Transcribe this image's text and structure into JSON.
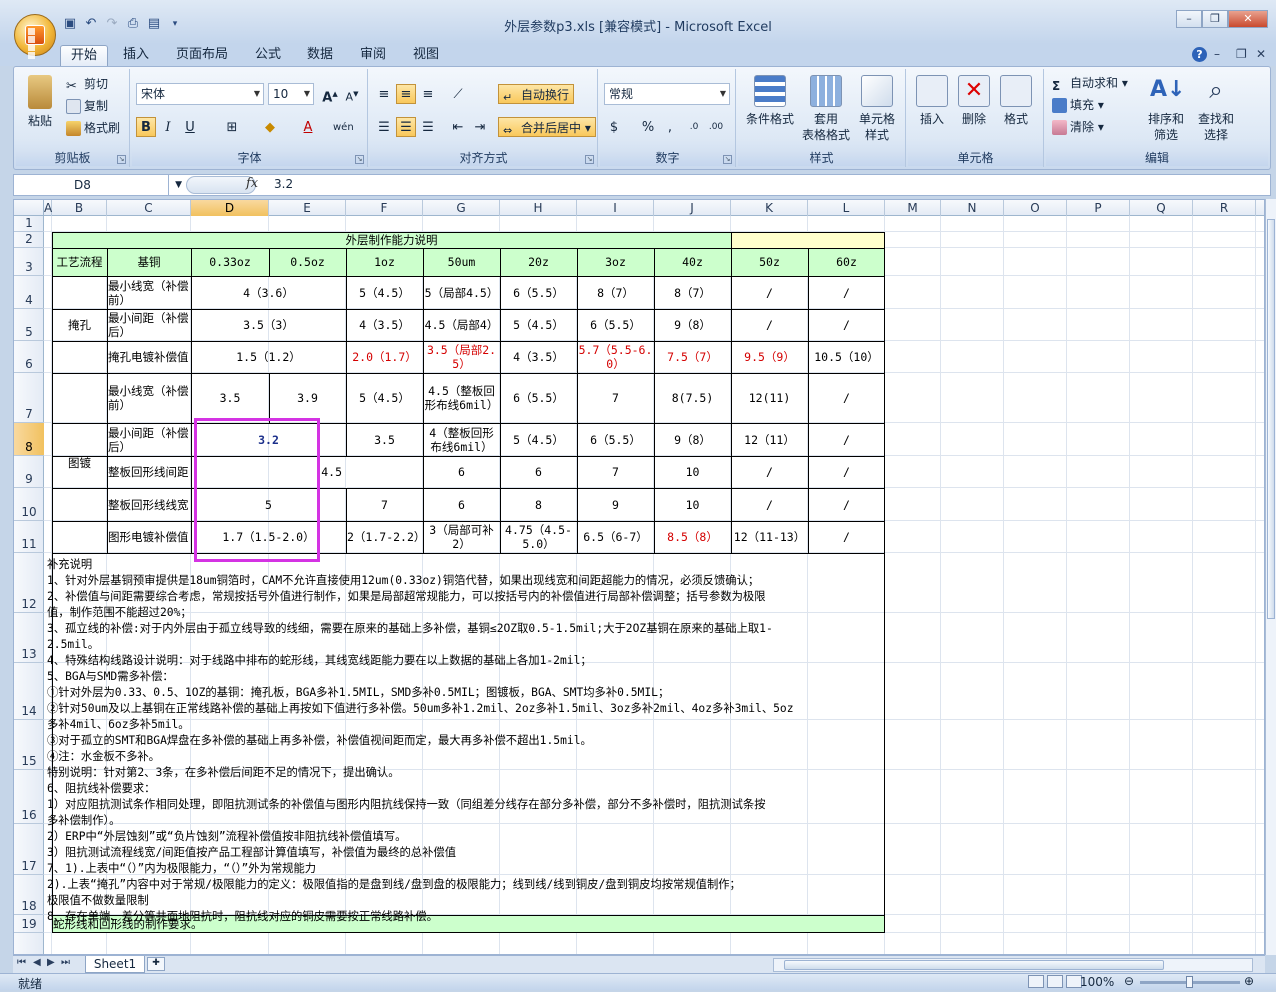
{
  "window": {
    "title": "外层参数p3.xls  [兼容模式] - Microsoft Excel"
  },
  "ribbon_tabs": [
    "开始",
    "插入",
    "页面布局",
    "公式",
    "数据",
    "审阅",
    "视图"
  ],
  "clipboard": {
    "paste": "粘贴",
    "cut": "剪切",
    "copy": "复制",
    "format_painter": "格式刷",
    "label": "剪贴板"
  },
  "font": {
    "name": "宋体",
    "size": "10",
    "label": "字体"
  },
  "alignment": {
    "wrap": "自动换行",
    "merge": "合并后居中",
    "label": "对齐方式"
  },
  "number": {
    "format": "常规",
    "label": "数字"
  },
  "styles": {
    "conditional": "条件格式",
    "table": "套用\n表格格式",
    "cell_style": "单元格\n样式",
    "label": "样式"
  },
  "cells_group": {
    "insert": "插入",
    "delete": "删除",
    "format": "格式",
    "label": "单元格"
  },
  "editing": {
    "autosum": "自动求和",
    "fill": "填充",
    "clear": "清除",
    "sort": "排序和\n筛选",
    "find": "查找和\n选择",
    "label": "编辑"
  },
  "formula_bar": {
    "name_box": "D8",
    "formula": "3.2"
  },
  "columns": [
    "A",
    "B",
    "C",
    "D",
    "E",
    "F",
    "G",
    "H",
    "I",
    "J",
    "K",
    "L",
    "M",
    "N",
    "O",
    "P",
    "Q",
    "R"
  ],
  "rows": [
    "1",
    "2",
    "3",
    "4",
    "5",
    "6",
    "7",
    "8",
    "9",
    "10",
    "11",
    "12",
    "13",
    "14",
    "15",
    "16",
    "17",
    "18",
    "19"
  ],
  "table": {
    "title": "外层制作能力说明",
    "headers": [
      "工艺流程",
      "基铜",
      "0.33oz",
      "0.5oz",
      "1oz",
      "50um",
      "20z",
      "3oz",
      "40z",
      "50z",
      "60z"
    ],
    "sec1": "掩孔",
    "sec2": "图镀",
    "r4": [
      "最小线宽（补偿前）",
      "4（3.6）",
      "5（4.5）",
      "5（局部4.5）",
      "6（5.5）",
      "8（7）",
      "8（7）",
      "/",
      "/"
    ],
    "r5": [
      "最小间距（补偿后）",
      "3.5（3）",
      "4（3.5）",
      "4.5（局部4）",
      "5（4.5）",
      "6（5.5）",
      "9（8）",
      "/",
      "/"
    ],
    "r6": [
      "掩孔电镀补偿值",
      "1.5（1.2）",
      "2.0（1.7）",
      "3.5（局部2.5）",
      "4（3.5）",
      "5.7（5.5-6.0）",
      "7.5（7）",
      "9.5（9）",
      "10.5（10）"
    ],
    "r7": [
      "最小线宽（补偿前）",
      "3.5",
      "3.9",
      "5（4.5）",
      "4.5（整板回形布线6mil）",
      "6（5.5）",
      "7",
      "8(7.5)",
      "12(11)",
      "/"
    ],
    "r8": [
      "最小间距（补偿后）",
      "3.2",
      "3.5",
      "4（整板回形布线6mil）",
      "5（4.5）",
      "6（5.5）",
      "9（8）",
      "12（11）",
      "/"
    ],
    "r9": [
      "整板回形线间距",
      "4.5",
      "6",
      "6",
      "7",
      "10",
      "/",
      "/"
    ],
    "r10": [
      "整板回形线线宽",
      "5",
      "7",
      "6",
      "8",
      "9",
      "10",
      "/",
      "/"
    ],
    "r11": [
      "图形电镀补偿值",
      "1.7（1.5-2.0）",
      "2（1.7-2.2）",
      "3（局部可补2）",
      "4.75（4.5-5.0）",
      "6.5（6-7）",
      "8.5（8）",
      "12（11-13）",
      "/"
    ]
  },
  "notes": [
    "补充说明",
    "1、针对外层基铜预审提供是18um铜箔时，CAM不允许直接使用12um(0.33oz)铜箔代替，如果出现线宽和间距超能力的情况，必须反馈确认；",
    "2、补偿值与间距需要综合考虑，常规按括号外值进行制作，如果是局部超常规能力，可以按括号内的补偿值进行局部补偿调整；括号参数为极限",
    "值，制作范围不能超过20%；",
    "3、孤立线的补偿:对于内外层由于孤立线导致的线细，需要在原来的基础上多补偿，基铜≤2OZ取0.5-1.5mil;大于2OZ基铜在原来的基础上取1-",
    "2.5mil。",
    "4、特殊结构线路设计说明：对于线路中排布的蛇形线，其线宽线距能力要在以上数据的基础上各加1-2mil；",
    "5、BGA与SMD需多补偿：",
    "①针对外层为0.33、0.5、1OZ的基铜：掩孔板，BGA多补1.5MIL，SMD多补0.5MIL；图镀板，BGA、SMT均多补0.5MIL；",
    "②针对50um及以上基铜在正常线路补偿的基础上再按如下值进行多补偿。50um多补1.2mil、2oz多补1.5mil、3oz多补2mil、4oz多补3mil、5oz",
    "多补4mil、6oz多补5mil。",
    "③对于孤立的SMT和BGA焊盘在多补偿的基础上再多补偿，补偿值视间距而定，最大再多补偿不超出1.5mil。",
    "④注：水金板不多补。",
    "特别说明：针对第2、3条，在多补偿后间距不足的情况下，提出确认。",
    "6、阻抗线补偿要求：",
    "1）对应阻抗测试条作相同处理，即阻抗测试条的补偿值与图形内阻抗线保持一致（同组差分线存在部分多补偿，部分不多补偿时，阻抗测试条按",
    "多补偿制作）。",
    "2）ERP中“外层蚀刻”或“负片蚀刻”流程补偿值按非阻抗线补偿值填写。",
    "3）阻抗测试流程线宽/间距值按产品工程部计算值填写，补偿值为最终的总补偿值",
    "7、1).上表中“（）”内为极限能力，“（）”外为常规能力",
    "    2).上表“掩孔”内容中对于常规/极限能力的定义：极限值指的是盘到线/盘到盘的极限能力；线到线/线到铜皮/盘到铜皮均按常规值制作；",
    "极限值不做数量限制",
    "8、存在单端、差分等共面地阻抗时，阻抗线对应的铜皮需要按正常线路补偿。"
  ],
  "row19_text": "蛇形线和回形线的制作要求。",
  "sheet_tab": "Sheet1",
  "status": {
    "ready": "就绪",
    "zoom": "100%"
  }
}
